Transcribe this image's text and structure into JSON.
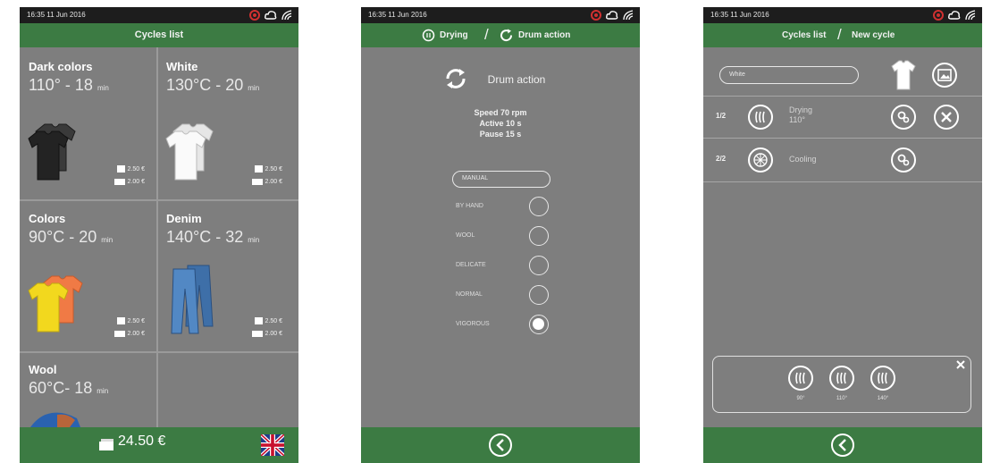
{
  "status_bar": {
    "time_date": "16:35  11 Jun 2016"
  },
  "screen1": {
    "header_title": "Cycles list",
    "cycles": [
      {
        "name": "Dark colors",
        "temp": "110° - 18",
        "unit": "min",
        "price_a": "2.50 €",
        "price_b": "2.00 €",
        "color": "#2b2b2b"
      },
      {
        "name": "White",
        "temp": "130°C - 20",
        "unit": "min",
        "price_a": "2.50 €",
        "price_b": "2.00 €",
        "color": "#f4f4f4"
      },
      {
        "name": "Colors",
        "temp": "90°C - 20",
        "unit": "min",
        "price_a": "2.50 €",
        "price_b": "2.00 €",
        "color": "#f0d21c"
      },
      {
        "name": "Denim",
        "temp": "140°C - 32",
        "unit": "min",
        "price_a": "2.50 €",
        "price_b": "2.00 €",
        "color": "#4a7db8"
      },
      {
        "name": "Wool",
        "temp": "60°C- 18",
        "unit": "min"
      }
    ],
    "total": "24.50 €"
  },
  "screen2": {
    "breadcrumb_first": "Drying",
    "breadcrumb_second": "Drum action",
    "title": "Drum action",
    "speed": "Speed  70 rpm",
    "active": "Active  10 s",
    "pause": "Pause  15 s",
    "mode_field": "MANUAL",
    "options": [
      "BY HAND",
      "WOOL",
      "DELICATE",
      "NORMAL",
      "VIGOROUS"
    ],
    "selected_option": "VIGOROUS"
  },
  "screen3": {
    "breadcrumb_first": "Cycles list",
    "breadcrumb_second": "New cycle",
    "name_field": "White",
    "steps": [
      {
        "index": "1/2",
        "name": "Drying",
        "detail": "110°"
      },
      {
        "index": "2/2",
        "name": "Cooling",
        "detail": ""
      }
    ],
    "presets": [
      "90°",
      "110°",
      "140°"
    ]
  },
  "colors": {
    "accent_green": "#3c7b43",
    "background_gray": "#7e7e7e"
  }
}
